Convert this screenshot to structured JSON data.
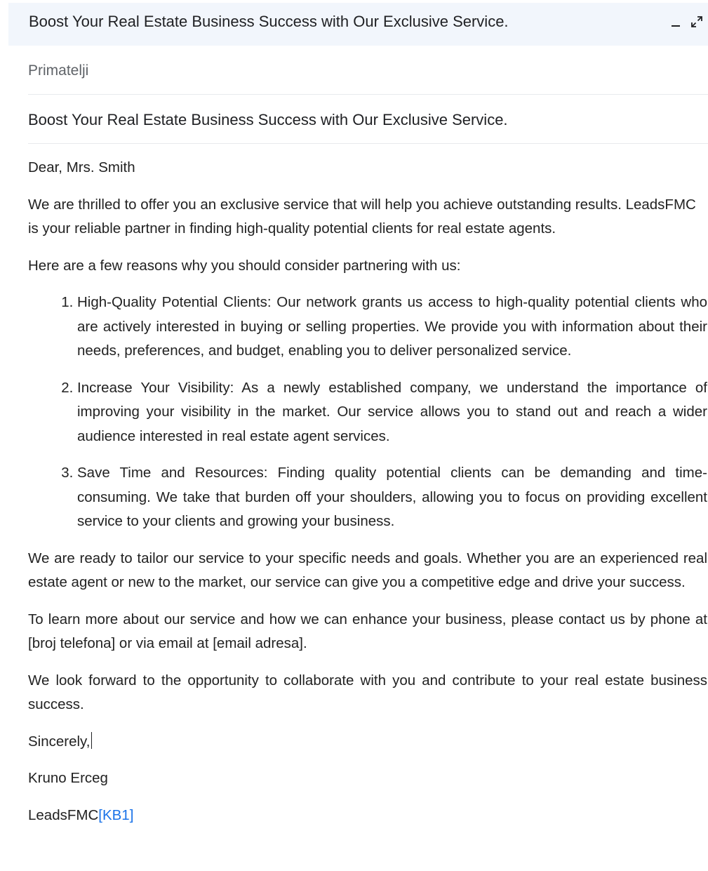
{
  "compose": {
    "title": "Boost Your Real Estate Business Success with Our Exclusive Service.",
    "recipients_placeholder": "Primatelji",
    "subject": "Boost Your Real Estate Business Success with Our Exclusive Service."
  },
  "body": {
    "greeting": "Dear, Mrs. Smith",
    "intro": "We are thrilled to offer you an exclusive service that will help you achieve outstanding results. LeadsFMC is your reliable partner in finding high-quality potential clients for real estate agents.",
    "reasons_lead": "Here are a few reasons why you should consider partnering with us:",
    "reasons": [
      "High-Quality Potential Clients: Our network grants us access to high-quality potential clients who are actively interested in buying or selling properties. We provide you with information about their needs, preferences, and budget, enabling you to deliver personalized service.",
      "Increase Your Visibility: As a newly established company, we understand the importance of improving your visibility in the market. Our service allows you to stand out and reach a wider audience interested in real estate agent services.",
      "Save Time and Resources: Finding quality potential clients can be demanding and time-consuming. We take that burden off your shoulders, allowing you to focus on providing excellent service to your clients and growing your business."
    ],
    "tailor": "We are ready to tailor our service to your specific needs and goals. Whether you are an experienced real estate agent or new to the market, our service can give you a competitive edge and drive your success.",
    "contact": "To learn more about our service and how we can enhance your business, please contact us by phone at [broj telefona] or via email at [email adresa].",
    "look_forward": "We look forward to the opportunity to collaborate with you and contribute to your real estate business success.",
    "closing": "Sincerely,",
    "signature_name": "Kruno Erceg",
    "signature_company": "LeadsFMC",
    "signature_comment_ref": "[KB1]"
  }
}
